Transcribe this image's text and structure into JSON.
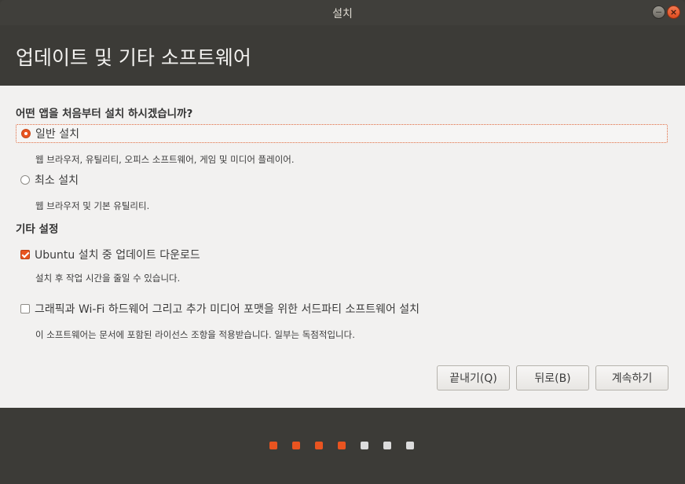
{
  "window": {
    "title": "설치",
    "minimize_glyph": "−",
    "close_glyph": "×"
  },
  "header": {
    "title": "업데이트 및 기타 소프트웨어"
  },
  "install_type": {
    "heading": "어떤 앱을 처음부터 설치 하시겠습니까?",
    "options": [
      {
        "label": "일반 설치",
        "description": "웹 브라우저, 유틸리티, 오피스  소프트웨어, 게임 및 미디어 플레이어.",
        "selected": true
      },
      {
        "label": "최소 설치",
        "description": "웹 브라우저 및 기본 유틸리티.",
        "selected": false
      }
    ]
  },
  "other_settings": {
    "heading": "기타 설정",
    "options": [
      {
        "label": "Ubuntu 설치 중 업데이트 다운로드",
        "description": "설치 후 작업 시간을 줄일 수 있습니다.",
        "checked": true
      },
      {
        "label": "그래픽과 Wi-Fi 하드웨어 그리고 추가 미디어 포맷을 위한 서드파티 소프트웨어 설치",
        "description": "이 소프트웨어는 문서에 포함된 라이선스 조항을 적용받습니다. 일부는 독점적입니다.",
        "checked": false
      }
    ]
  },
  "buttons": {
    "quit": "끝내기(Q)",
    "back": "뒤로(B)",
    "continue": "계속하기"
  },
  "progress": {
    "total_steps": 7,
    "completed_steps": 4
  },
  "colors": {
    "accent": "#e95420",
    "dot_active": "#e95420",
    "dot_inactive": "#dcdcdc",
    "header_bg": "#3c3b37",
    "content_bg": "#f2f1f0"
  }
}
